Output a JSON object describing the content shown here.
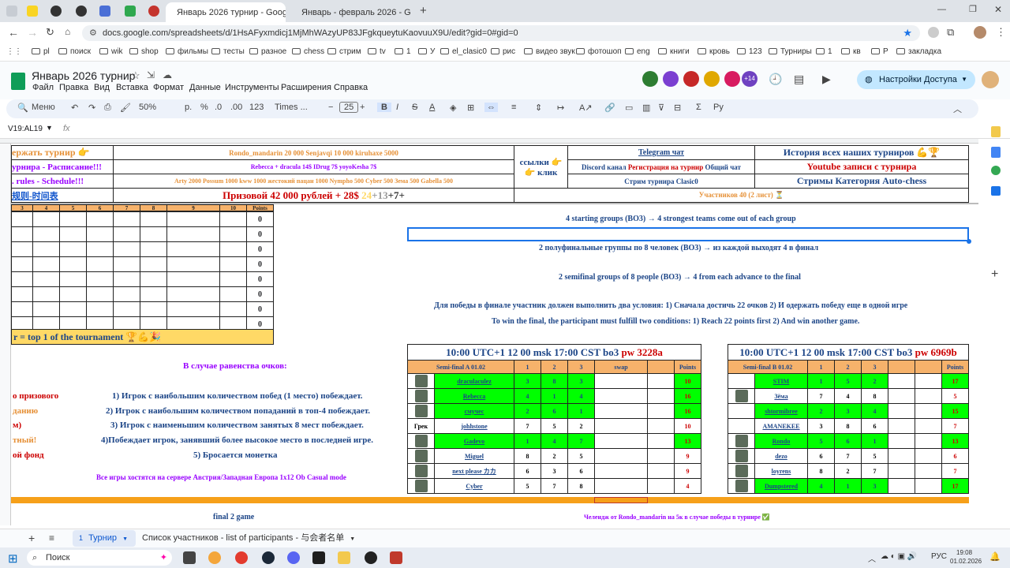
{
  "browser": {
    "tabs": [
      {
        "label": "Январь 2026 турнир - Google",
        "active": true
      },
      {
        "label": "Январь - февраль 2026 - Goo",
        "active": false
      }
    ],
    "url": "docs.google.com/spreadsheets/d/1HsAFyxmdicj1MjMhWAzyUP83JFgkqueytuKaovuuX9U/edit?gid=0#gid=0",
    "bookmarks": [
      "pl",
      "поиск",
      "wik",
      "shop",
      "фильмы",
      "тесты",
      "разное",
      "chess",
      "стрим",
      "tv",
      "1",
      "У",
      "el_clasic0",
      "рис",
      "видео звук",
      "фотошоп",
      "eng",
      "книги",
      "кровь",
      "123",
      "Турниры",
      "1",
      "кв",
      "Р",
      "закладка"
    ]
  },
  "sheets": {
    "doc_title": "Январь 2026 турнир",
    "menus": [
      "Файл",
      "Правка",
      "Вид",
      "Вставка",
      "Формат",
      "Данные",
      "Инструменты",
      "Расширения",
      "Справка"
    ],
    "share_label": "Настройки Доступа",
    "collab_count": "+14",
    "toolbar": {
      "search": "Меню",
      "zoom": "50%",
      "currency": "р.",
      "percent": "%",
      "dec1": ".0",
      "dec2": ".00",
      "numfmt": "123",
      "font": "Times ...",
      "size": "25"
    },
    "cell_ref": "V19:AL19",
    "fx": "fx"
  },
  "top": {
    "r1a": "ержать турнир 👉",
    "r1b": "Rondo_mandarin 20 000  Senjavqi 10 000  kiruhaxe 5000",
    "r2a": "урнира - Расписание!!!",
    "r2b": "Rebecca + dracula 14$ IDrug 7$ yoyoKesha 7$",
    "r3a": ". rules - Schedule!!!",
    "r3b": "Arty 2000 Possum 1000 kww 1000 жестокий пацан 1000 Nympho 500 Cyber 500 Зема 500  Gabella 500",
    "r4a": "规则-时间表",
    "r4b": "Призовой 42 000  рублей + 28$",
    "r4c": "24",
    "r4d": "+13",
    "r4e": "+7+",
    "links1": "ссылки 👉",
    "links2": "👉 клик",
    "tg": "Telegram чат",
    "discord": "Discord канал",
    "reg": "Регистрация на турнир",
    "chat": "Общий чат",
    "stream": "Стрим турнира Clasic0",
    "history": "История всех наших турниров 💪🏆",
    "youtube": "Youtube записи с турнира",
    "streams": "Стримы Категория Auto-chess",
    "participants": "Участников 40 (2 лист) ⏳"
  },
  "left": {
    "headers": [
      "3",
      "4",
      "5",
      "6",
      "7",
      "8",
      "9",
      "10",
      "Points"
    ],
    "points": [
      "0",
      "0",
      "0",
      "0",
      "0",
      "0",
      "0",
      "0"
    ],
    "banner": "r = top 1 of the tournament 🏆💪🎉",
    "tie_title": "В случае равенства очков:",
    "rules": [
      {
        "side": "о призового",
        "text": "1) Игрок с наибольшим количеством побед (1 место) побеждает."
      },
      {
        "side": "данию",
        "text": "2) Игрок с наибольшим количеством попаданий в топ-4 побеждает."
      },
      {
        "side": "м)",
        "text": "3) Игрок с наименьшим количеством занятых 8 мест побеждает."
      },
      {
        "side": "тный!",
        "text": "4)Побеждает игрок, занявший более высокое место в последней игре."
      },
      {
        "side": "ой фонд",
        "text": "5) Бросается монетка"
      }
    ],
    "server": "Все игры хостятся на сервере Австрия/Западная Европа 1x12 Ob Casual mode"
  },
  "info": {
    "l1": "4 starting groups (BO3) → 4 strongest teams come out of each group",
    "l2": "2 полуфинальные группы по 8 человек (ВО3) → из каждой выходят 4 в финал",
    "l3": "2 semifinal groups of 8 people (BO3) → 4 from each advance to the final",
    "l4": "Для победы в финале участник должен выполнить два условия: 1) Сначала достичь 22 очков   2) И одержать победу еще в одной игре",
    "l5": "To win the final, the participant must fulfill two conditions: 1) Reach 22 points first 2) And win another game."
  },
  "semiA": {
    "time": "10:00 UTC+1 12 00 msk  17:00 CST bo3 ",
    "pw": "pw 3228a",
    "title": "Semi-final A 01.02",
    "cols": [
      "1",
      "2",
      "3",
      "swap",
      "",
      "Points"
    ],
    "rows": [
      {
        "name": "draculaculez",
        "g": [
          "3",
          "8",
          "3"
        ],
        "pts": "10",
        "green": true,
        "avatar": true
      },
      {
        "name": "Rebecca",
        "g": [
          "4",
          "1",
          "4"
        ],
        "pts": "16",
        "green": true,
        "avatar": true
      },
      {
        "name": "смучес",
        "g": [
          "2",
          "6",
          "1"
        ],
        "pts": "16",
        "green": true,
        "avatar": true
      },
      {
        "name": "johhstone",
        "g": [
          "7",
          "5",
          "2"
        ],
        "pts": "10",
        "green": false,
        "avatar": false,
        "prefix": "Грек"
      },
      {
        "name": "Gadevo",
        "g": [
          "1",
          "4",
          "7"
        ],
        "pts": "13",
        "green": true,
        "avatar": true
      },
      {
        "name": "Miguel",
        "g": [
          "8",
          "2",
          "5"
        ],
        "pts": "9",
        "green": false,
        "avatar": true
      },
      {
        "name": "next please カカ",
        "g": [
          "6",
          "3",
          "6"
        ],
        "pts": "9",
        "green": false,
        "avatar": true
      },
      {
        "name": "Cyber",
        "g": [
          "5",
          "7",
          "8"
        ],
        "pts": "4",
        "green": false,
        "avatar": true
      }
    ]
  },
  "semiB": {
    "time": "10:00 UTC+1 12 00 msk  17:00 CST bo3 ",
    "pw": "pw 6969b",
    "title": "Semi-final B 01.02",
    "cols": [
      "1",
      "2",
      "3",
      "",
      "",
      "Points"
    ],
    "rows": [
      {
        "name": "STIM",
        "g": [
          "1",
          "5",
          "2"
        ],
        "pts": "17",
        "green": true,
        "avatar": false
      },
      {
        "name": "Зёма",
        "g": [
          "7",
          "4",
          "8"
        ],
        "pts": "5",
        "green": false,
        "avatar": true
      },
      {
        "name": "shtormibree",
        "g": [
          "2",
          "3",
          "4"
        ],
        "pts": "15",
        "green": true,
        "avatar": false
      },
      {
        "name": "AMANEKEE",
        "g": [
          "3",
          "8",
          "6"
        ],
        "pts": "7",
        "green": false,
        "avatar": false
      },
      {
        "name": "Rondo",
        "g": [
          "5",
          "6",
          "1"
        ],
        "pts": "13",
        "green": true,
        "avatar": true
      },
      {
        "name": "dezo",
        "g": [
          "6",
          "7",
          "5"
        ],
        "pts": "6",
        "green": false,
        "avatar": true
      },
      {
        "name": "loyrens",
        "g": [
          "8",
          "2",
          "7"
        ],
        "pts": "7",
        "green": false,
        "avatar": true
      },
      {
        "name": "Dumpstered",
        "g": [
          "4",
          "1",
          "3"
        ],
        "pts": "17",
        "green": true,
        "avatar": true
      }
    ]
  },
  "bottom": {
    "final": "final 2 game",
    "challenge": "Челендж от  Rondo_mandarin на 5к в случае победы в турнире ✅"
  },
  "sheet_tabs": [
    {
      "label": "Турнир",
      "active": true
    },
    {
      "label": "Список участников - list of participants - 与会者名单",
      "active": false
    }
  ],
  "taskbar": {
    "search": "Поиск",
    "lang": "РУС",
    "time": "19:08",
    "date": "01.02.2026"
  },
  "colors": {
    "green": "#00ff00",
    "orange": "#f6b26b",
    "yellow": "#ffd966",
    "link": "#1155cc",
    "accent": "#0b57d0"
  }
}
